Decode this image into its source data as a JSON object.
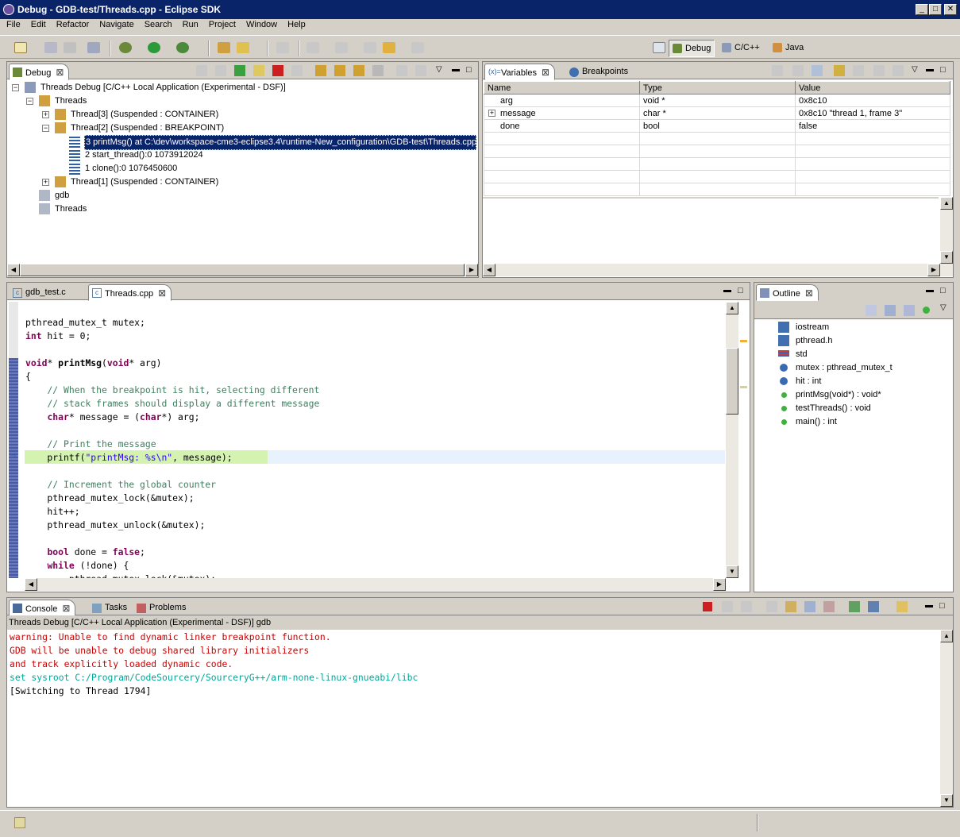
{
  "window": {
    "title": "Debug - GDB-test/Threads.cpp - Eclipse SDK"
  },
  "menu": [
    "File",
    "Edit",
    "Refactor",
    "Navigate",
    "Search",
    "Run",
    "Project",
    "Window",
    "Help"
  ],
  "perspectives": {
    "debug": "Debug",
    "cpp": "C/C++",
    "java": "Java"
  },
  "debug_view": {
    "tab": "Debug",
    "tree": [
      "Threads Debug [C/C++ Local Application (Experimental - DSF)]",
      "Threads",
      "Thread[3]  (Suspended : CONTAINER)",
      "Thread[2]  (Suspended : BREAKPOINT)",
      "3 printMsg() at C:\\dev\\workspace-cme3-eclipse3.4\\runtime-New_configuration\\GDB-test\\Threads.cpp:",
      "2 start_thread():0 1073912024",
      "1 clone():0 1076450600",
      "Thread[1]  (Suspended : CONTAINER)",
      "gdb",
      "Threads"
    ]
  },
  "variables_view": {
    "tabs": {
      "variables": "Variables",
      "breakpoints": "Breakpoints"
    },
    "columns": [
      "Name",
      "Type",
      "Value"
    ],
    "rows": [
      {
        "name": "arg",
        "type": "void *",
        "value": "0x8c10"
      },
      {
        "name": "message",
        "type": "char *",
        "value": "0x8c10 \"thread 1, frame 3\""
      },
      {
        "name": "done",
        "type": "bool",
        "value": "false"
      }
    ]
  },
  "editor": {
    "tabs": {
      "gdb_test": "gdb_test.c",
      "threads": "Threads.cpp"
    }
  },
  "outline": {
    "tab": "Outline",
    "items": [
      "iostream",
      "pthread.h",
      "std",
      "mutex : pthread_mutex_t",
      "hit : int",
      "printMsg(void*) : void*",
      "testThreads() : void",
      "main() : int"
    ]
  },
  "console": {
    "tabs": {
      "console": "Console",
      "tasks": "Tasks",
      "problems": "Problems"
    },
    "header": "Threads Debug [C/C++ Local Application (Experimental - DSF)] gdb",
    "lines": [
      "warning: Unable to find dynamic linker breakpoint function.",
      "GDB will be unable to debug shared library initializers",
      "and track explicitly loaded dynamic code.",
      "set sysroot C:/Program/CodeSourcery/SourceryG++/arm-none-linux-gnueabi/libc",
      "[Switching to Thread 1794]"
    ]
  },
  "colors": {
    "selection": "#0a246a",
    "console_error": "#cc0000",
    "console_cmd": "#00a89a",
    "current_line": "#e8f2fe",
    "exec_line": "#d4f2b0"
  }
}
